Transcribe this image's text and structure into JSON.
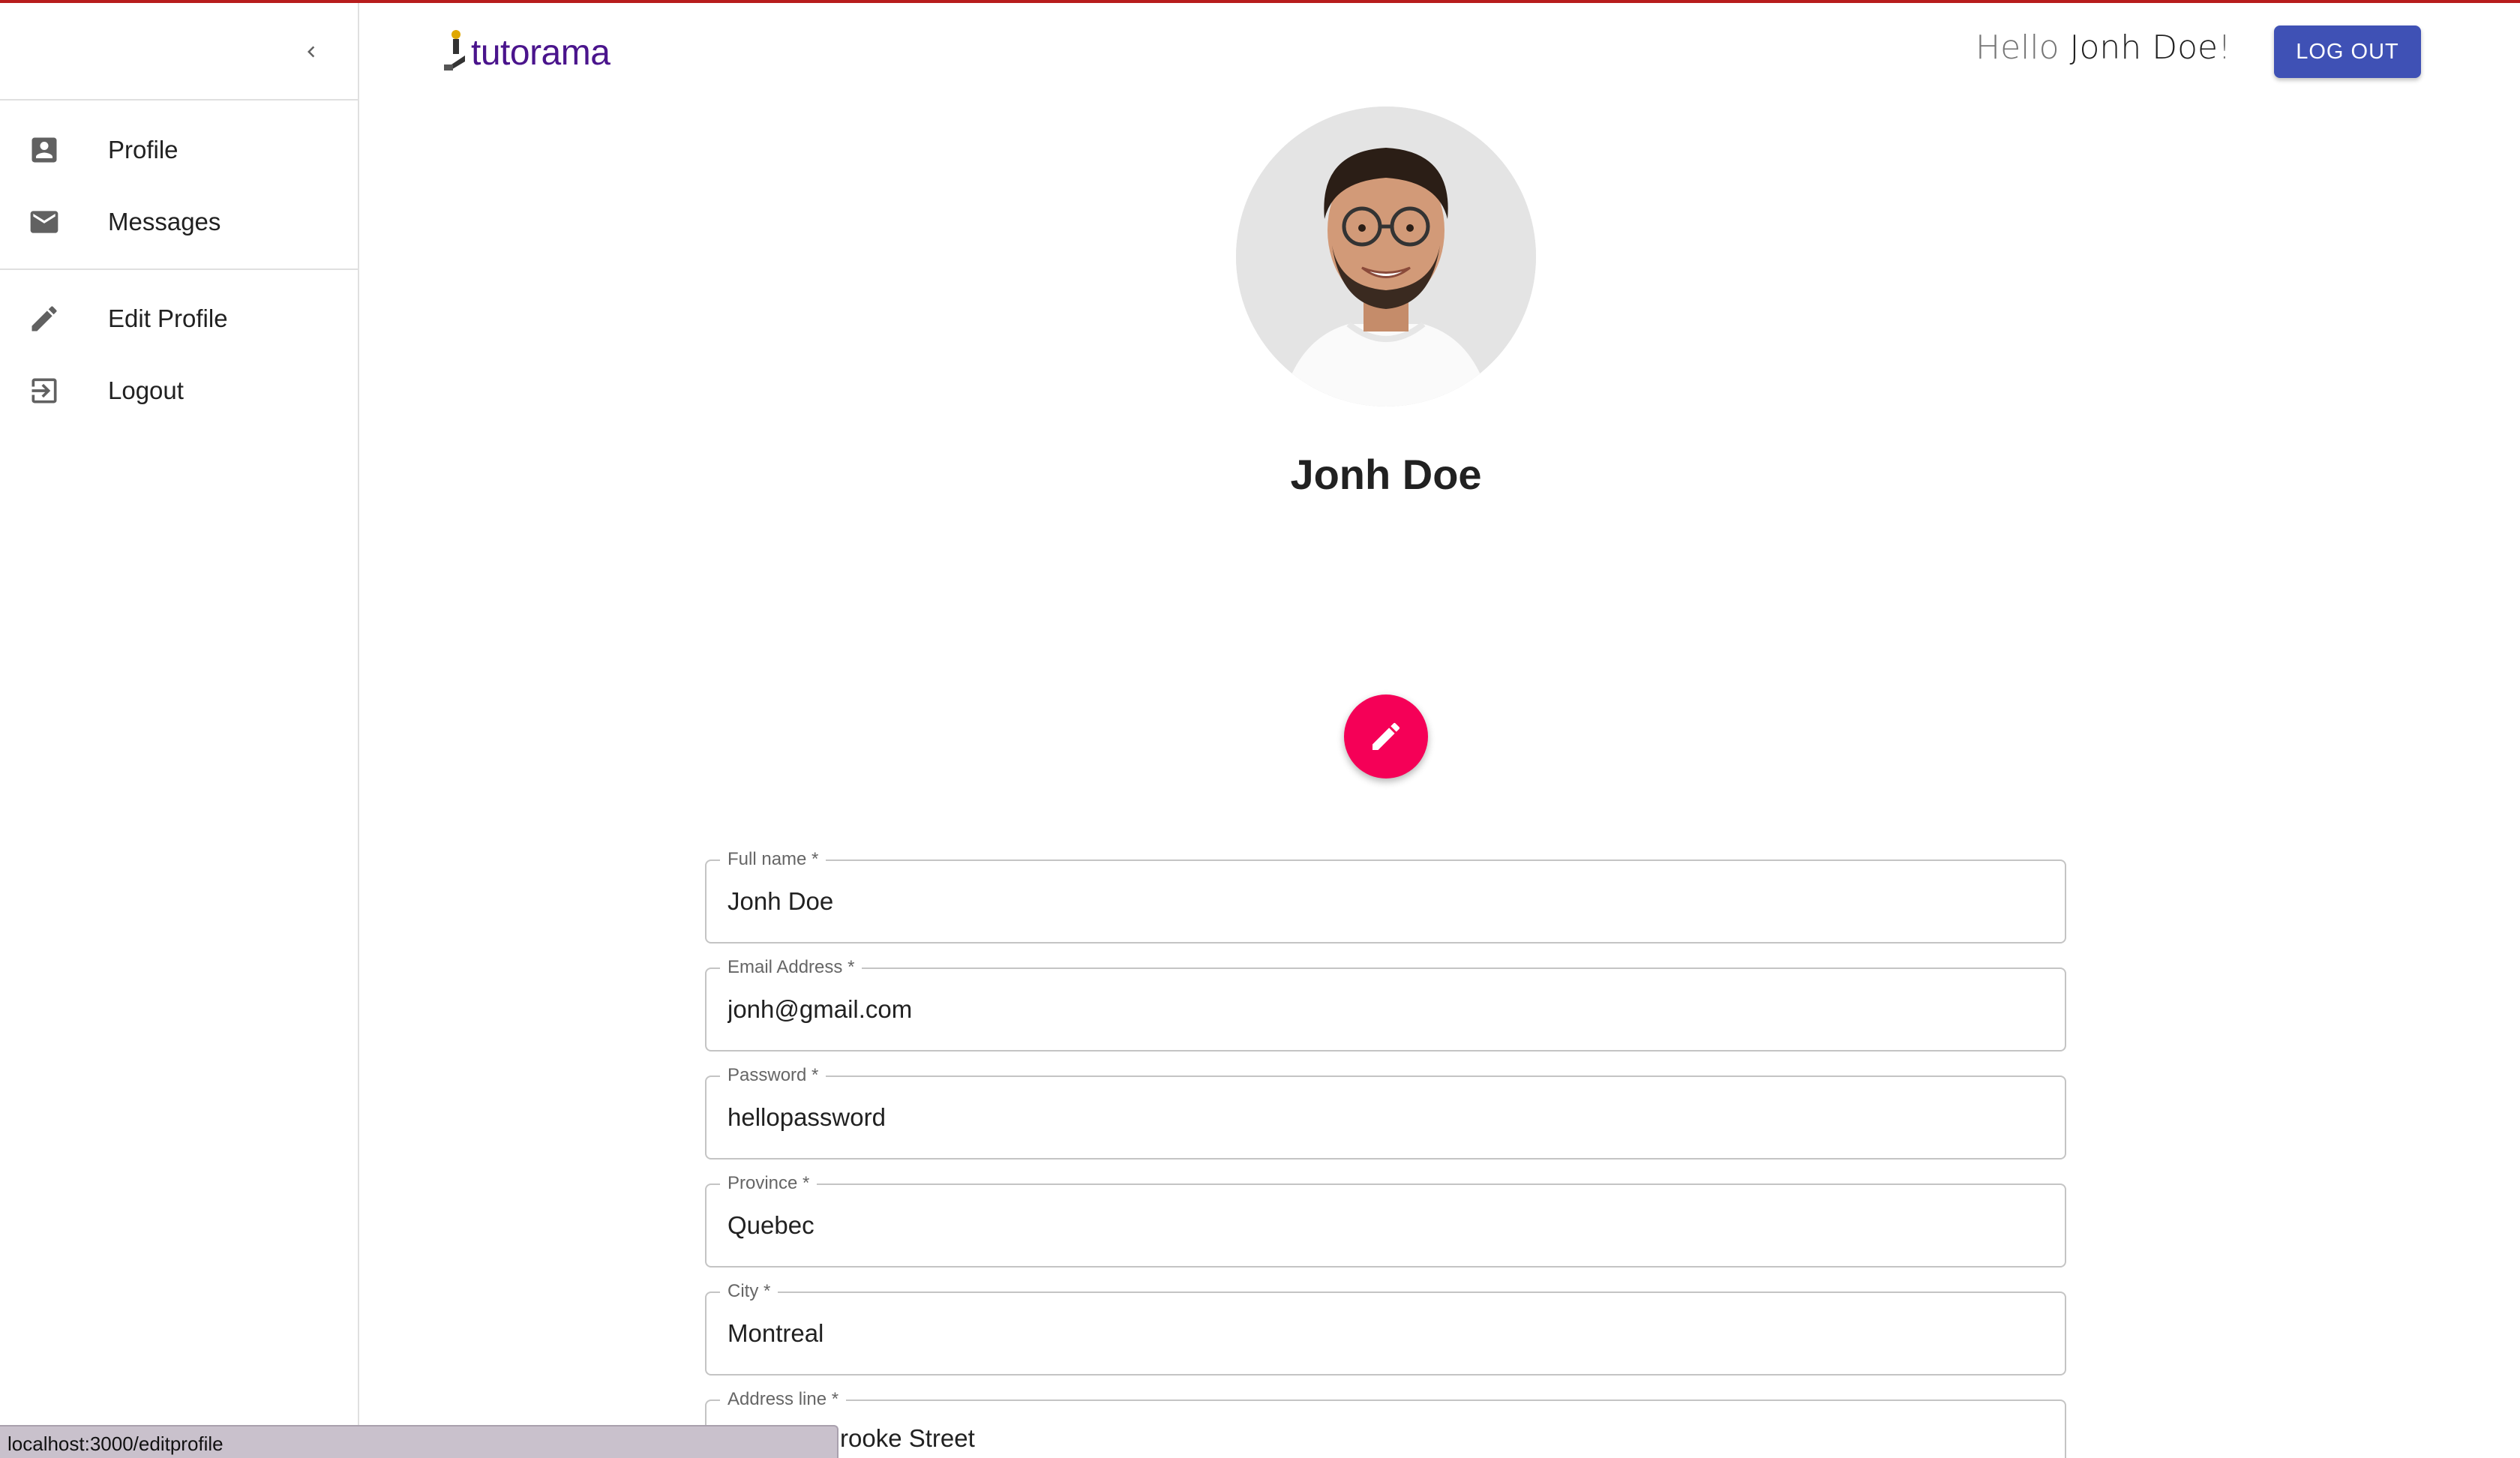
{
  "app": {
    "logo_text": "tutorama",
    "accent_color": "#3f51b5",
    "brand_color": "#4a148c"
  },
  "header": {
    "greeting_prefix": "Hello",
    "greeting_name": "Jonh Doe",
    "greeting_suffix": "!",
    "logout_label": "LOG OUT"
  },
  "sidebar": {
    "collapse_icon": "chevron-left-icon",
    "items": [
      {
        "label": "Profile",
        "icon": "account-box-icon"
      },
      {
        "label": "Messages",
        "icon": "mail-icon"
      },
      {
        "label": "Edit Profile",
        "icon": "pencil-icon"
      },
      {
        "label": "Logout",
        "icon": "exit-icon"
      }
    ]
  },
  "profile": {
    "name": "Jonh Doe",
    "edit_fab_icon": "pencil-icon",
    "fab_color": "#f50057"
  },
  "form": {
    "fields": [
      {
        "label": "Full name",
        "required": "*",
        "value": "Jonh Doe"
      },
      {
        "label": "Email Address",
        "required": "*",
        "value": "jonh@gmail.com"
      },
      {
        "label": "Password",
        "required": "*",
        "value": "hellopassword"
      },
      {
        "label": "Province",
        "required": "*",
        "value": "Quebec"
      },
      {
        "label": "City",
        "required": "*",
        "value": "Montreal"
      },
      {
        "label": "Address line",
        "required": "*",
        "value": "rooke Street"
      }
    ]
  },
  "status_bar": {
    "url": "localhost:3000/editprofile"
  }
}
